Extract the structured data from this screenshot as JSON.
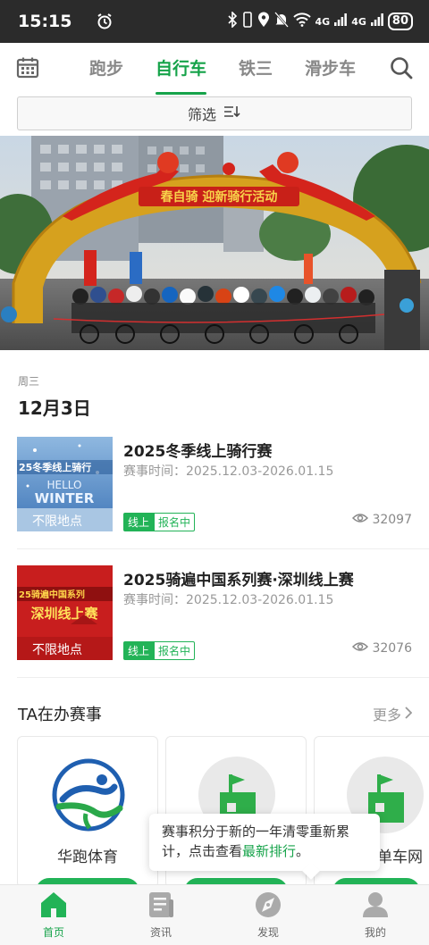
{
  "status_bar": {
    "time": "15:15",
    "signal1": "4G",
    "signal2": "4G",
    "battery": "80"
  },
  "nav": {
    "tabs": [
      {
        "label": "跑步"
      },
      {
        "label": "自行车"
      },
      {
        "label": "铁三"
      },
      {
        "label": "滑步车"
      }
    ],
    "active_tab": "自行车",
    "accent_color": "#16a34a"
  },
  "filter": {
    "label": "筛选"
  },
  "banner": {
    "arch_text": "春自骑  迎新骑行活动"
  },
  "date_group": {
    "weekday": "周三",
    "date": "12月3日"
  },
  "events": [
    {
      "title": "2025冬季线上骑行赛",
      "time_label": "赛事时间：",
      "time_range": "2025.12.03-2026.01.15",
      "tag_mode": "线上",
      "tag_status": "报名中",
      "views": "32097",
      "thumb_line1": "25冬季线上骑行",
      "thumb_line2": "HELLO",
      "thumb_line3": "WINTER",
      "thumb_line4": "不限地点"
    },
    {
      "title": "2025骑遍中国系列赛·深圳线上赛",
      "time_label": "赛事时间：",
      "time_range": "2025.12.03-2026.01.15",
      "tag_mode": "线上",
      "tag_status": "报名中",
      "views": "32076",
      "thumb_line1": "25骑遍中国系列",
      "thumb_line2": "深圳线上赛",
      "thumb_line4": "不限地点"
    }
  ],
  "organizers_section": {
    "title": "TA在办赛事",
    "more": "更多"
  },
  "organizers": [
    {
      "name": "华跑体育"
    },
    {
      "name": ""
    },
    {
      "name": "单车网"
    }
  ],
  "toast": {
    "text_before": "赛事积分于新的一年清零重新累计，点击查看",
    "link": "最新排行",
    "text_after": "。"
  },
  "bottom_nav": [
    {
      "label": "首页",
      "icon": "home-icon"
    },
    {
      "label": "资讯",
      "icon": "news-icon"
    },
    {
      "label": "发现",
      "icon": "discover-icon"
    },
    {
      "label": "我的",
      "icon": "profile-icon"
    }
  ]
}
